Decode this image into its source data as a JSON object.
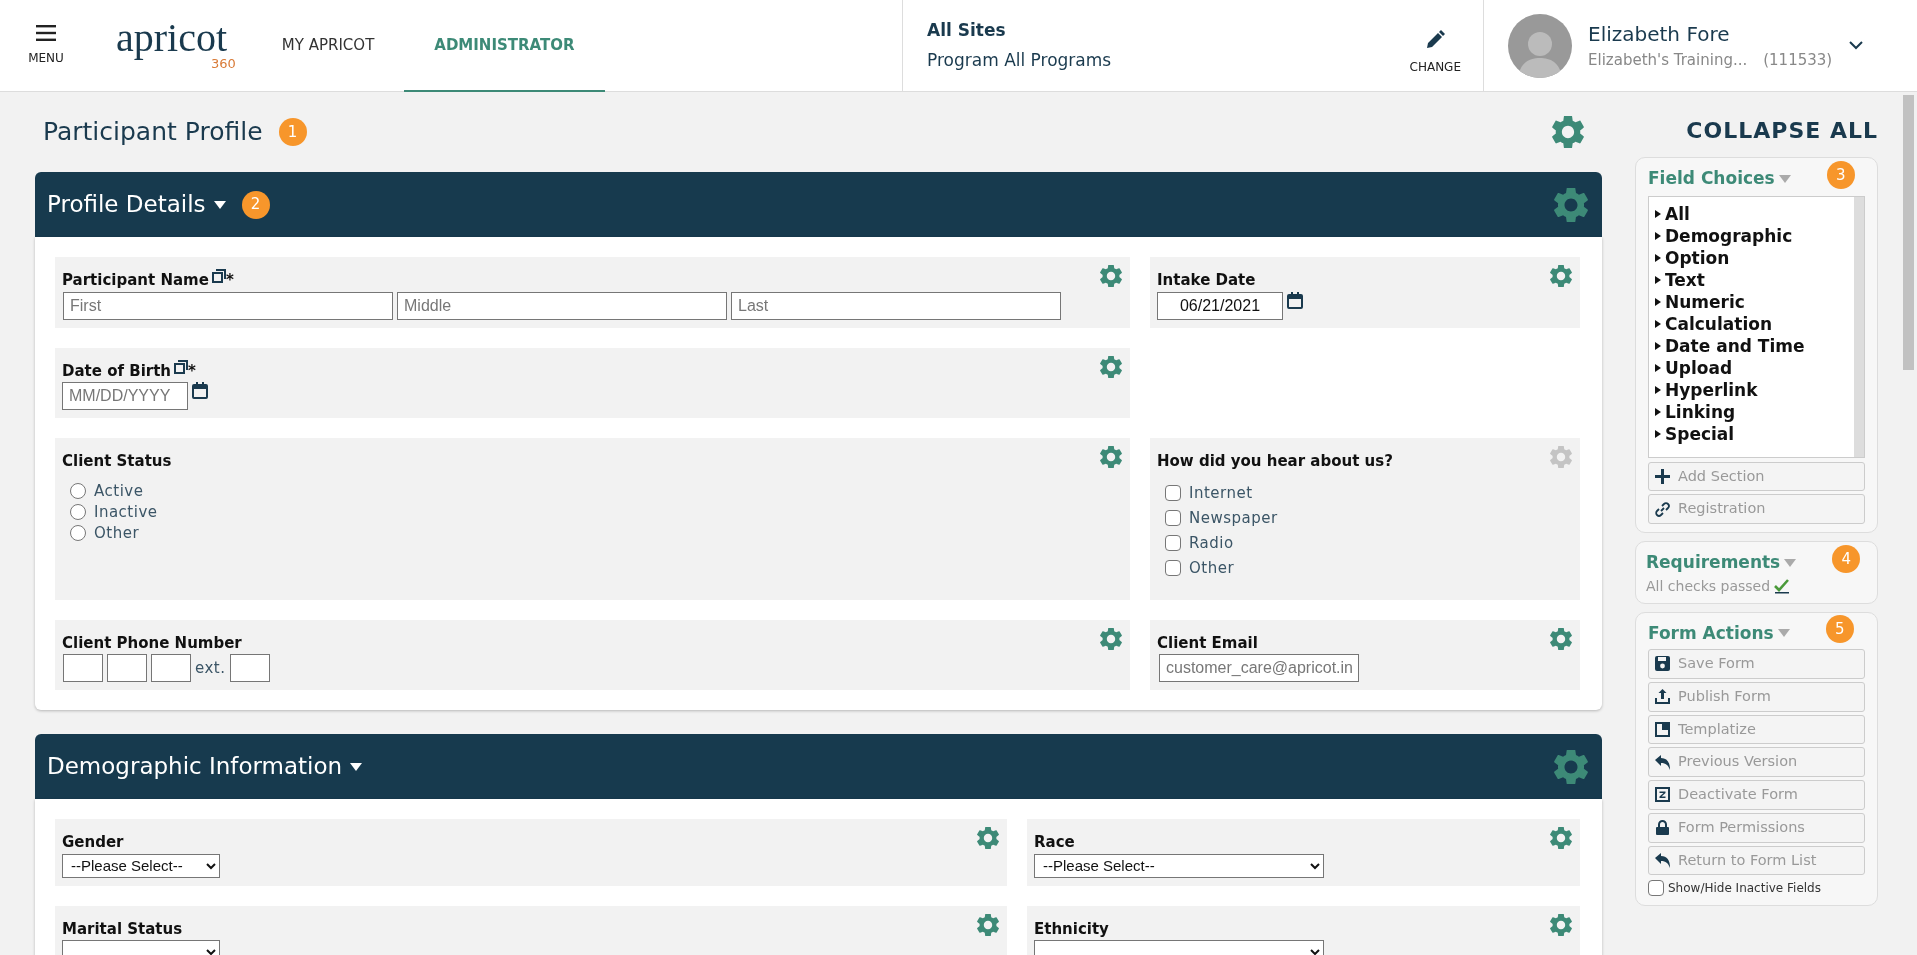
{
  "header": {
    "menu_label": "MENU",
    "logo": {
      "word": "apricot",
      "sub": "360"
    },
    "tabs": [
      {
        "label": "MY APRICOT",
        "selected": false
      },
      {
        "label": "ADMINISTRATOR",
        "selected": true
      }
    ],
    "site": {
      "title": "All Sites",
      "program": "Program All Programs"
    },
    "change_label": "CHANGE",
    "user": {
      "name": "Elizabeth Fore",
      "org": "Elizabeth's Training...",
      "id": "(111533)"
    }
  },
  "page": {
    "title": "Participant Profile",
    "badge": "1"
  },
  "sections": [
    {
      "title": "Profile Details",
      "badge": "2",
      "rows": [
        {
          "fields": [
            {
              "kind": "name",
              "label": "Participant Name",
              "required_mark": "*",
              "settings_enabled": true,
              "inputs": [
                {
                  "placeholder": "First"
                },
                {
                  "placeholder": "Middle"
                },
                {
                  "placeholder": "Last"
                }
              ]
            },
            {
              "kind": "date",
              "label": "Intake Date",
              "settings_enabled": true,
              "value": "06/21/2021"
            }
          ]
        },
        {
          "fields": [
            {
              "kind": "date",
              "label": "Date of Birth",
              "required_mark": "*",
              "settings_enabled": true,
              "placeholder": "MM/DD/YYYY"
            }
          ]
        },
        {
          "fields": [
            {
              "kind": "radio",
              "label": "Client Status",
              "settings_enabled": true,
              "options": [
                {
                  "label": "Active",
                  "selected": false
                },
                {
                  "label": "Inactive",
                  "selected": false
                },
                {
                  "label": "Other",
                  "selected": false
                }
              ]
            },
            {
              "kind": "checkbox",
              "label": "How did you hear about us?",
              "settings_enabled": false,
              "options": [
                {
                  "label": "Internet",
                  "checked": false
                },
                {
                  "label": "Newspaper",
                  "checked": false
                },
                {
                  "label": "Radio",
                  "checked": false
                },
                {
                  "label": "Other",
                  "checked": false
                }
              ]
            }
          ]
        },
        {
          "fields": [
            {
              "kind": "phone",
              "label": "Client Phone Number",
              "settings_enabled": true,
              "ext_label": "ext."
            },
            {
              "kind": "email",
              "label": "Client Email",
              "settings_enabled": true,
              "placeholder": "customer_care@apricot.in"
            }
          ]
        }
      ]
    },
    {
      "title": "Demographic Information",
      "rows": [
        {
          "fields": [
            {
              "kind": "select",
              "label": "Gender",
              "settings_enabled": true,
              "value": "--Please Select--"
            },
            {
              "kind": "select",
              "label": "Race",
              "settings_enabled": true,
              "value": "--Please Select--"
            }
          ]
        },
        {
          "fields": [
            {
              "kind": "select",
              "label": "Marital Status",
              "settings_enabled": true
            },
            {
              "kind": "select",
              "label": "Ethnicity",
              "settings_enabled": true
            }
          ]
        }
      ]
    }
  ],
  "side": {
    "collapse_label": "COLLAPSE ALL",
    "panels": [
      {
        "kind": "choices",
        "title": "Field Choices",
        "badge": "3",
        "items": [
          "All",
          "Demographic",
          "Option",
          "Text",
          "Numeric",
          "Calculation",
          "Date and Time",
          "Upload",
          "Hyperlink",
          "Linking",
          "Special"
        ],
        "buttons": [
          {
            "kind": "plus",
            "label": "Add Section",
            "disabled": true
          },
          {
            "kind": "link",
            "label": "Registration",
            "disabled": true
          }
        ]
      },
      {
        "kind": "requirements",
        "title": "Requirements",
        "badge": "4",
        "status": "All checks passed"
      },
      {
        "kind": "actions",
        "title": "Form Actions",
        "badge": "5",
        "buttons": [
          {
            "kind": "save",
            "label": "Save Form",
            "disabled": true
          },
          {
            "kind": "upload",
            "label": "Publish Form",
            "disabled": true
          },
          {
            "kind": "template",
            "label": "Templatize",
            "disabled": true
          },
          {
            "kind": "undo",
            "label": "Previous Version",
            "disabled": true
          },
          {
            "kind": "z",
            "label": "Deactivate Form",
            "disabled": true
          },
          {
            "kind": "lock",
            "label": "Form Permissions",
            "disabled": true
          },
          {
            "kind": "undo",
            "label": "Return to Form List",
            "disabled": true
          }
        ],
        "checkbox": {
          "label": "Show/Hide Inactive Fields",
          "checked": false
        }
      }
    ]
  }
}
